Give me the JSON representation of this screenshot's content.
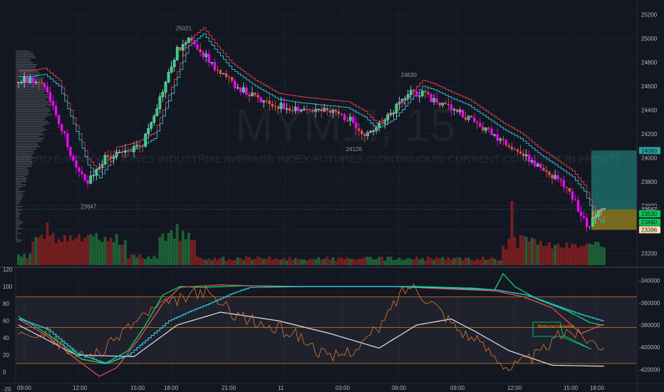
{
  "chart_data": [
    {
      "type": "candlestick",
      "watermark_symbol": "MYM1!, 15",
      "watermark_name": "MICRO E-MINI DOW JONES INDUSTRIAL AVERAGE INDEX FUTURES (CONTINUOUS: CURRENT CONTRACT IN FRONT)",
      "ylim": [
        23100,
        25250
      ],
      "yticks": [
        23200,
        23400,
        23600,
        23800,
        24000,
        24200,
        24400,
        24600,
        24800,
        25000,
        25200
      ],
      "xticks": [
        "09:00",
        "12:00",
        "15:00",
        "18:00",
        "21:00",
        "11",
        "03:00",
        "06:00",
        "09:00",
        "12:00",
        "15:00",
        "18:00"
      ],
      "price_path": [
        [
          0,
          24640
        ],
        [
          5,
          24660
        ],
        [
          10,
          24560
        ],
        [
          16,
          24180
        ],
        [
          20,
          23900
        ],
        [
          24,
          23790
        ],
        [
          30,
          24000
        ],
        [
          37,
          24040
        ],
        [
          43,
          24120
        ],
        [
          49,
          24500
        ],
        [
          55,
          24900
        ],
        [
          60,
          25000
        ],
        [
          64,
          24870
        ],
        [
          70,
          24700
        ],
        [
          78,
          24560
        ],
        [
          86,
          24450
        ],
        [
          94,
          24420
        ],
        [
          102,
          24400
        ],
        [
          110,
          24380
        ],
        [
          116,
          24300
        ],
        [
          120,
          24200
        ],
        [
          126,
          24280
        ],
        [
          132,
          24450
        ],
        [
          136,
          24560
        ],
        [
          140,
          24530
        ],
        [
          146,
          24460
        ],
        [
          152,
          24400
        ],
        [
          158,
          24300
        ],
        [
          164,
          24200
        ],
        [
          170,
          24120
        ],
        [
          176,
          24000
        ],
        [
          182,
          23900
        ],
        [
          188,
          23800
        ],
        [
          192,
          23680
        ],
        [
          195,
          23500
        ],
        [
          198,
          23420
        ],
        [
          201,
          23567
        ]
      ],
      "price_labels": [
        {
          "text": "25021",
          "index": 57,
          "price": 25021
        },
        {
          "text": "23647",
          "index": 24,
          "price": 23647
        },
        {
          "text": "24630",
          "index": 135,
          "price": 24630
        },
        {
          "text": "24126",
          "index": 116,
          "price": 24126
        }
      ],
      "tags": [
        {
          "text": "24060",
          "price": 24060,
          "bg": "#26a69a",
          "fg": "#131722"
        },
        {
          "text": "23567",
          "price": 23567,
          "bg": "#1e222d",
          "fg": "#d1d4dc"
        },
        {
          "text": "23530",
          "price": 23530,
          "bg": "#00c853",
          "fg": "#131722"
        },
        {
          "text": "23460",
          "price": 23460,
          "bg": "#00c853",
          "fg": "#131722"
        },
        {
          "text": "23396",
          "price": 23396,
          "bg": "#ffe0b2",
          "fg": "#131722"
        }
      ],
      "zone_upper": [
        23567,
        24060
      ],
      "zone_lower": [
        23396,
        23567
      ],
      "colors": {
        "bull": "#26a69a",
        "bear": "#ef5350",
        "magenta": "#ff00ff",
        "brightgreen": "#00e676",
        "outline": "#d1d4dc",
        "stepRed": "#e04040",
        "stepTeal": "#26c6da"
      }
    },
    {
      "type": "line",
      "ylim": [
        -10,
        120
      ],
      "yticks": [
        -20,
        0,
        20,
        40,
        60,
        80,
        100,
        120
      ],
      "secondary_yticks": [
        "-340000",
        "-360000",
        "-380000",
        "-400000",
        "-420000"
      ],
      "secondary_ylim": [
        -430000,
        -330000
      ],
      "levels": [
        10,
        52,
        88
      ],
      "note": "Rebound formation",
      "series": [
        {
          "key": "white",
          "path": [
            [
              0,
              55
            ],
            [
              20,
              20
            ],
            [
              40,
              18
            ],
            [
              55,
              55
            ],
            [
              70,
              70
            ],
            [
              90,
              60
            ],
            [
              108,
              45
            ],
            [
              125,
              28
            ],
            [
              138,
              55
            ],
            [
              150,
              62
            ],
            [
              158,
              48
            ],
            [
              170,
              25
            ],
            [
              185,
              8
            ],
            [
              200,
              7
            ]
          ]
        },
        {
          "key": "orange",
          "path": [
            [
              0,
              52
            ],
            [
              10,
              45
            ],
            [
              20,
              18
            ],
            [
              30,
              25
            ],
            [
              36,
              48
            ],
            [
              46,
              72
            ],
            [
              56,
              85
            ],
            [
              64,
              95
            ],
            [
              74,
              70
            ],
            [
              84,
              55
            ],
            [
              96,
              45
            ],
            [
              108,
              15
            ],
            [
              118,
              30
            ],
            [
              126,
              55
            ],
            [
              132,
              90
            ],
            [
              136,
              102
            ],
            [
              144,
              80
            ],
            [
              152,
              52
            ],
            [
              162,
              28
            ],
            [
              170,
              5
            ],
            [
              180,
              20
            ],
            [
              190,
              50
            ],
            [
              198,
              38
            ],
            [
              202,
              32
            ]
          ]
        },
        {
          "key": "green",
          "path": [
            [
              0,
              65
            ],
            [
              5,
              55
            ],
            [
              12,
              40
            ],
            [
              22,
              15
            ],
            [
              30,
              10
            ],
            [
              38,
              25
            ],
            [
              44,
              55
            ],
            [
              50,
              90
            ],
            [
              56,
              100
            ],
            [
              64,
              99
            ],
            [
              78,
              101
            ],
            [
              98,
              100
            ],
            [
              118,
              100
            ],
            [
              138,
              100
            ],
            [
              158,
              98
            ],
            [
              165,
              96
            ],
            [
              168,
              115
            ],
            [
              172,
              100
            ],
            [
              180,
              85
            ],
            [
              190,
              72
            ],
            [
              198,
              58
            ],
            [
              202,
              55
            ]
          ]
        },
        {
          "key": "red",
          "path": [
            [
              0,
              62
            ],
            [
              10,
              42
            ],
            [
              20,
              15
            ],
            [
              28,
              -5
            ],
            [
              34,
              5
            ],
            [
              42,
              40
            ],
            [
              50,
              80
            ],
            [
              56,
              99
            ],
            [
              70,
              102
            ],
            [
              90,
              100
            ],
            [
              110,
              100
            ],
            [
              130,
              100
            ],
            [
              150,
              97
            ],
            [
              165,
              95
            ],
            [
              175,
              88
            ],
            [
              185,
              75
            ],
            [
              195,
              45
            ],
            [
              202,
              55
            ]
          ]
        },
        {
          "key": "teal",
          "path": [
            [
              0,
              62
            ],
            [
              10,
              50
            ],
            [
              20,
              22
            ],
            [
              30,
              10
            ],
            [
              38,
              20
            ],
            [
              45,
              40
            ],
            [
              52,
              60
            ],
            [
              60,
              72
            ],
            [
              66,
              80
            ],
            [
              74,
              92
            ],
            [
              80,
              99
            ],
            [
              100,
              100
            ],
            [
              130,
              100
            ],
            [
              150,
              98
            ],
            [
              165,
              96
            ],
            [
              176,
              90
            ],
            [
              184,
              80
            ],
            [
              194,
              68
            ],
            [
              202,
              60
            ]
          ]
        }
      ]
    }
  ]
}
